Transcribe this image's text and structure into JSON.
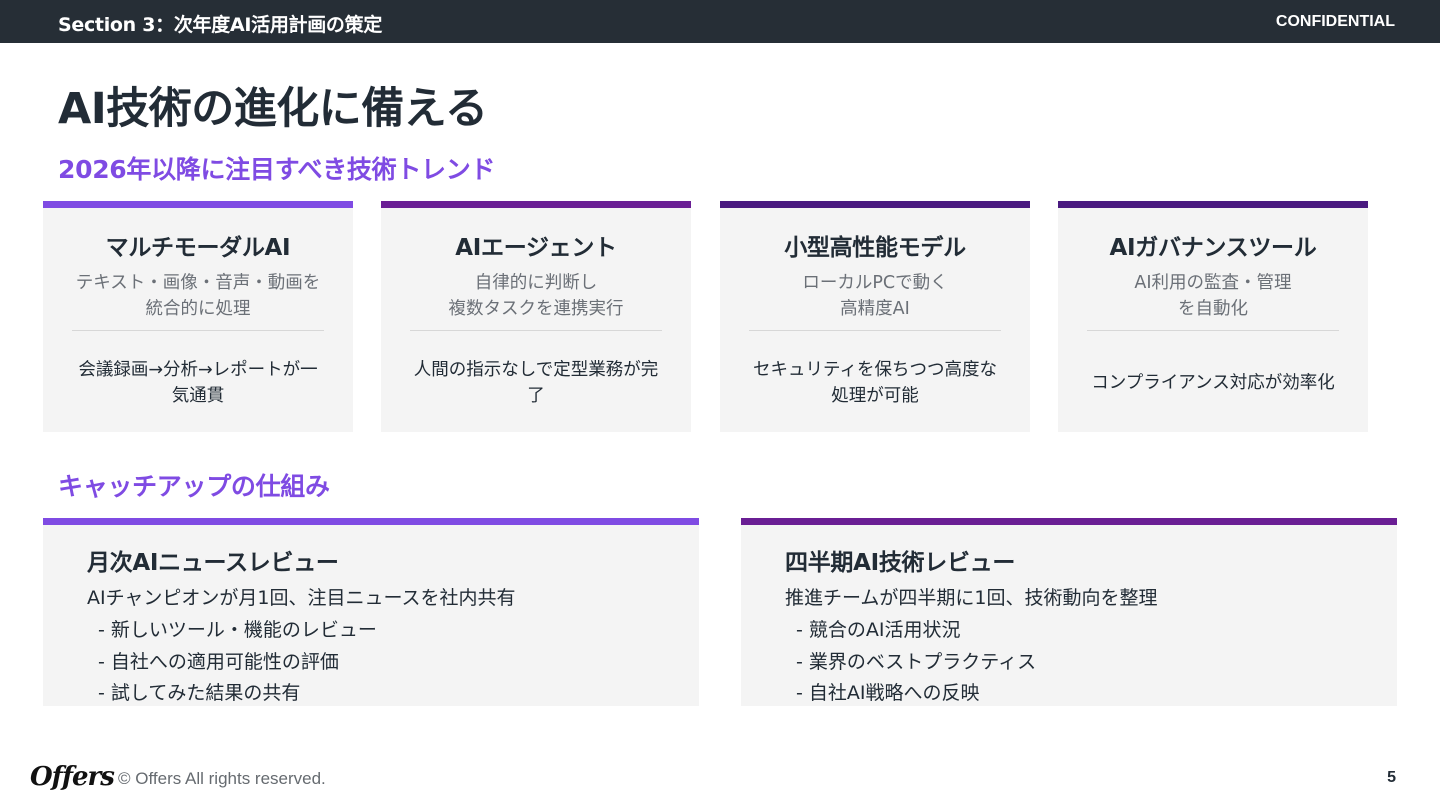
{
  "header": {
    "section_title": "Section 3：次年度AI活用計画の策定",
    "confidential": "CONFIDENTIAL",
    "background_color": "#262e36"
  },
  "page_title": "AI技術の進化に備える",
  "trends": {
    "heading": "2026年以降に注目すべき技術トレンド",
    "cards": [
      {
        "title": "マルチモーダルAI",
        "desc_lines": [
          "テキスト・画像・音声・動画を",
          "統合的に処理"
        ],
        "point_lines": [
          "会議録画→分析→レポートが一",
          "気通貫"
        ],
        "accent": "#7f4be3"
      },
      {
        "title": "AIエージェント",
        "desc_lines": [
          "自律的に判断し",
          "複数タスクを連携実行"
        ],
        "point_lines": [
          "人間の指示なしで定型業務が完",
          "了"
        ],
        "accent": "#6a1e94"
      },
      {
        "title": "小型高性能モデル",
        "desc_lines": [
          "ローカルPCで動く",
          "高精度AI"
        ],
        "point_lines": [
          "セキュリティを保ちつつ高度な",
          "処理が可能"
        ],
        "accent": "#4a1a80"
      },
      {
        "title": "AIガバナンスツール",
        "desc_lines": [
          "AI利用の監査・管理",
          "を自動化"
        ],
        "point_lines": [
          "コンプライアンス対応が効率化"
        ],
        "accent": "#4a1a80"
      }
    ]
  },
  "mechanism": {
    "heading": "キャッチアップの仕組み",
    "cards": [
      {
        "title": "月次AIニュースレビュー",
        "desc": "AIチャンピオンが月1回、注目ニュースを社内共有",
        "items": [
          "- 新しいツール・機能のレビュー",
          "- 自社への適用可能性の評価",
          "- 試してみた結果の共有"
        ],
        "accent": "#7f4be3"
      },
      {
        "title": "四半期AI技術レビュー",
        "desc": "推進チームが四半期に1回、技術動向を整理",
        "items": [
          "- 競合のAI活用状況",
          "- 業界のベストプラクティス",
          "- 自社AI戦略への反映"
        ],
        "accent": "#6a1e94"
      }
    ]
  },
  "footer": {
    "logo": "Offers",
    "copyright": "© Offers All rights reserved.",
    "page_number": "5"
  },
  "colors": {
    "accent_purple": "#7f4be3",
    "card_background": "#f4f4f4",
    "text_dark": "#222c36",
    "text_muted": "#6b7077"
  }
}
